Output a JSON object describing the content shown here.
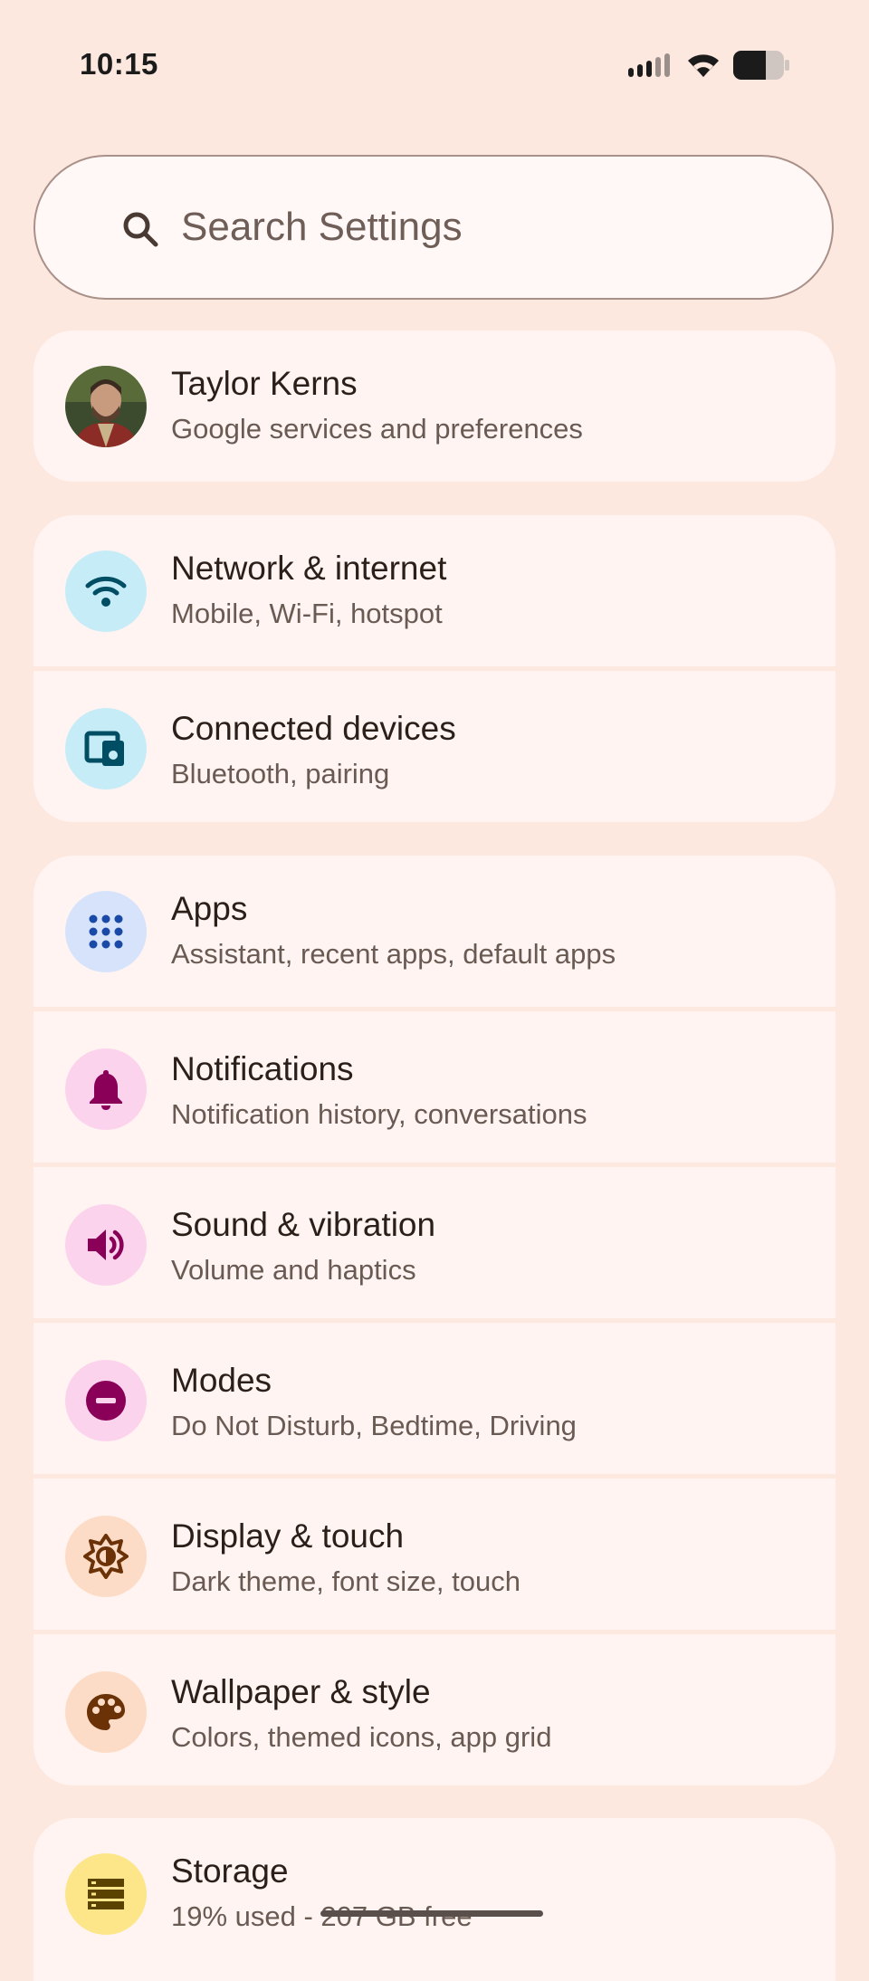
{
  "status_bar": {
    "time": "10:15",
    "signal_icon": "signal-icon",
    "wifi_icon": "wifi-icon",
    "battery_icon": "battery-icon"
  },
  "search": {
    "placeholder": "Search Settings",
    "icon": "search-icon"
  },
  "account": {
    "name": "Taylor Kerns",
    "subtitle": "Google services and preferences"
  },
  "groups": [
    {
      "items": [
        {
          "title": "Network & internet",
          "subtitle": "Mobile, Wi-Fi, hotspot",
          "icon": "wifi-icon",
          "icon_bg": "#c6ecf8",
          "icon_fg": "#004e63"
        },
        {
          "title": "Connected devices",
          "subtitle": "Bluetooth, pairing",
          "icon": "connected-devices-icon",
          "icon_bg": "#c6ecf8",
          "icon_fg": "#004e63"
        }
      ]
    },
    {
      "items": [
        {
          "title": "Apps",
          "subtitle": "Assistant, recent apps, default apps",
          "icon": "apps-grid-icon",
          "icon_bg": "#d6e3fb",
          "icon_fg": "#1a4aa8"
        },
        {
          "title": "Notifications",
          "subtitle": "Notification history, conversations",
          "icon": "bell-icon",
          "icon_bg": "#fbd3ec",
          "icon_fg": "#8a0058"
        },
        {
          "title": "Sound & vibration",
          "subtitle": "Volume and haptics",
          "icon": "speaker-icon",
          "icon_bg": "#fbd3ec",
          "icon_fg": "#8a0058"
        },
        {
          "title": "Modes",
          "subtitle": "Do Not Disturb, Bedtime, Driving",
          "icon": "do-not-disturb-icon",
          "icon_bg": "#fbd3ec",
          "icon_fg": "#8a0058"
        },
        {
          "title": "Display & touch",
          "subtitle": "Dark theme, font size, touch",
          "icon": "brightness-icon",
          "icon_bg": "#fcdcc6",
          "icon_fg": "#6b3208"
        },
        {
          "title": "Wallpaper & style",
          "subtitle": "Colors, themed icons, app grid",
          "icon": "palette-icon",
          "icon_bg": "#fcdcc6",
          "icon_fg": "#6b3208"
        }
      ]
    },
    {
      "items": [
        {
          "title": "Storage",
          "subtitle": "19% used - 207 GB free",
          "icon": "storage-icon",
          "icon_bg": "#fde68a",
          "icon_fg": "#5a4300"
        }
      ]
    }
  ]
}
